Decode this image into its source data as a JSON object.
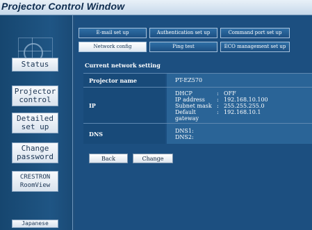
{
  "window": {
    "title": "Projector Control Window"
  },
  "sidebar": {
    "items": [
      {
        "label": "Status"
      },
      {
        "label": "Projector\ncontrol"
      },
      {
        "label": "Detailed\nset up"
      },
      {
        "label": "Change\npassword"
      },
      {
        "label": "CRESTRON\nRoomView"
      },
      {
        "label": "Japanese"
      }
    ]
  },
  "tabs": [
    {
      "label": "E-mail set up",
      "active": false
    },
    {
      "label": "Authentication set up",
      "active": false
    },
    {
      "label": "Command port set up",
      "active": false
    },
    {
      "label": "Network config",
      "active": true
    },
    {
      "label": "Ping test",
      "active": false
    },
    {
      "label": "ECO management set up",
      "active": false
    }
  ],
  "main": {
    "section_title": "Current network setting",
    "projector": {
      "label": "Projector name",
      "value": "PT-EZ570"
    },
    "ip": {
      "label": "IP",
      "items": [
        {
          "key": "DHCP",
          "sep": ":",
          "value": "OFF"
        },
        {
          "key": "IP address",
          "sep": ":",
          "value": "192.168.10.100"
        },
        {
          "key": "Subnet mask",
          "sep": ":",
          "value": "255.255.255.0"
        },
        {
          "key": "Default gateway",
          "sep": ":",
          "value": "192.168.10.1"
        }
      ]
    },
    "dns": {
      "label": "DNS",
      "items": [
        {
          "key": "DNS1:"
        },
        {
          "key": "DNS2:"
        }
      ]
    },
    "buttons": {
      "back": "Back",
      "change": "Change"
    }
  }
}
